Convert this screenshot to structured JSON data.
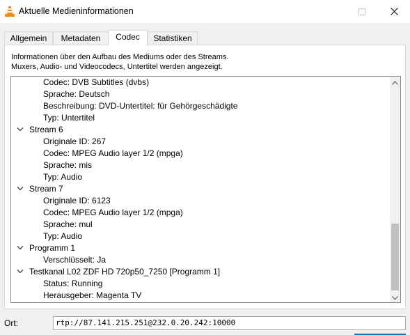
{
  "window": {
    "title": "Aktuelle Medieninformationen"
  },
  "tabs": [
    {
      "label": "Allgemein",
      "active": false
    },
    {
      "label": "Metadaten",
      "active": false
    },
    {
      "label": "Codec",
      "active": true
    },
    {
      "label": "Statistiken",
      "active": false
    }
  ],
  "info": {
    "line1": "Informationen über den Aufbau des Mediums oder des Streams.",
    "line2": "Muxers, Audio- und Videocodecs, Untertitel werden angezeigt."
  },
  "tree": {
    "rows": [
      {
        "level": 1,
        "text": "Codec: DVB Subtitles (dvbs)"
      },
      {
        "level": 1,
        "text": "Sprache: Deutsch"
      },
      {
        "level": 1,
        "text": "Beschreibung: DVD-Untertitel: für Gehörgeschädigte"
      },
      {
        "level": 1,
        "text": "Typ: Untertitel"
      },
      {
        "level": 0,
        "text": "Stream 6",
        "expanded": true
      },
      {
        "level": 1,
        "text": "Originale ID: 267"
      },
      {
        "level": 1,
        "text": "Codec: MPEG Audio layer 1/2 (mpga)"
      },
      {
        "level": 1,
        "text": "Sprache: mis"
      },
      {
        "level": 1,
        "text": "Typ: Audio"
      },
      {
        "level": 0,
        "text": "Stream 7",
        "expanded": true
      },
      {
        "level": 1,
        "text": "Originale ID: 6123"
      },
      {
        "level": 1,
        "text": "Codec: MPEG Audio layer 1/2 (mpga)"
      },
      {
        "level": 1,
        "text": "Sprache: mul"
      },
      {
        "level": 1,
        "text": "Typ: Audio"
      },
      {
        "level": 0,
        "text": "Programm 1",
        "expanded": true
      },
      {
        "level": 1,
        "text": "Verschlüsselt: Ja"
      },
      {
        "level": 0,
        "text": "Testkanal L02 ZDF HD 720p50_7250 [Programm 1]",
        "expanded": true
      },
      {
        "level": 1,
        "text": "Status: Running"
      },
      {
        "level": 1,
        "text": "Herausgeber: Magenta TV"
      }
    ]
  },
  "location": {
    "label": "Ort:",
    "value": "rtp://87.141.215.251@232.0.20.242:10000"
  },
  "colors": {
    "accent": "#0078d7",
    "vlc_orange": "#ff8800"
  }
}
